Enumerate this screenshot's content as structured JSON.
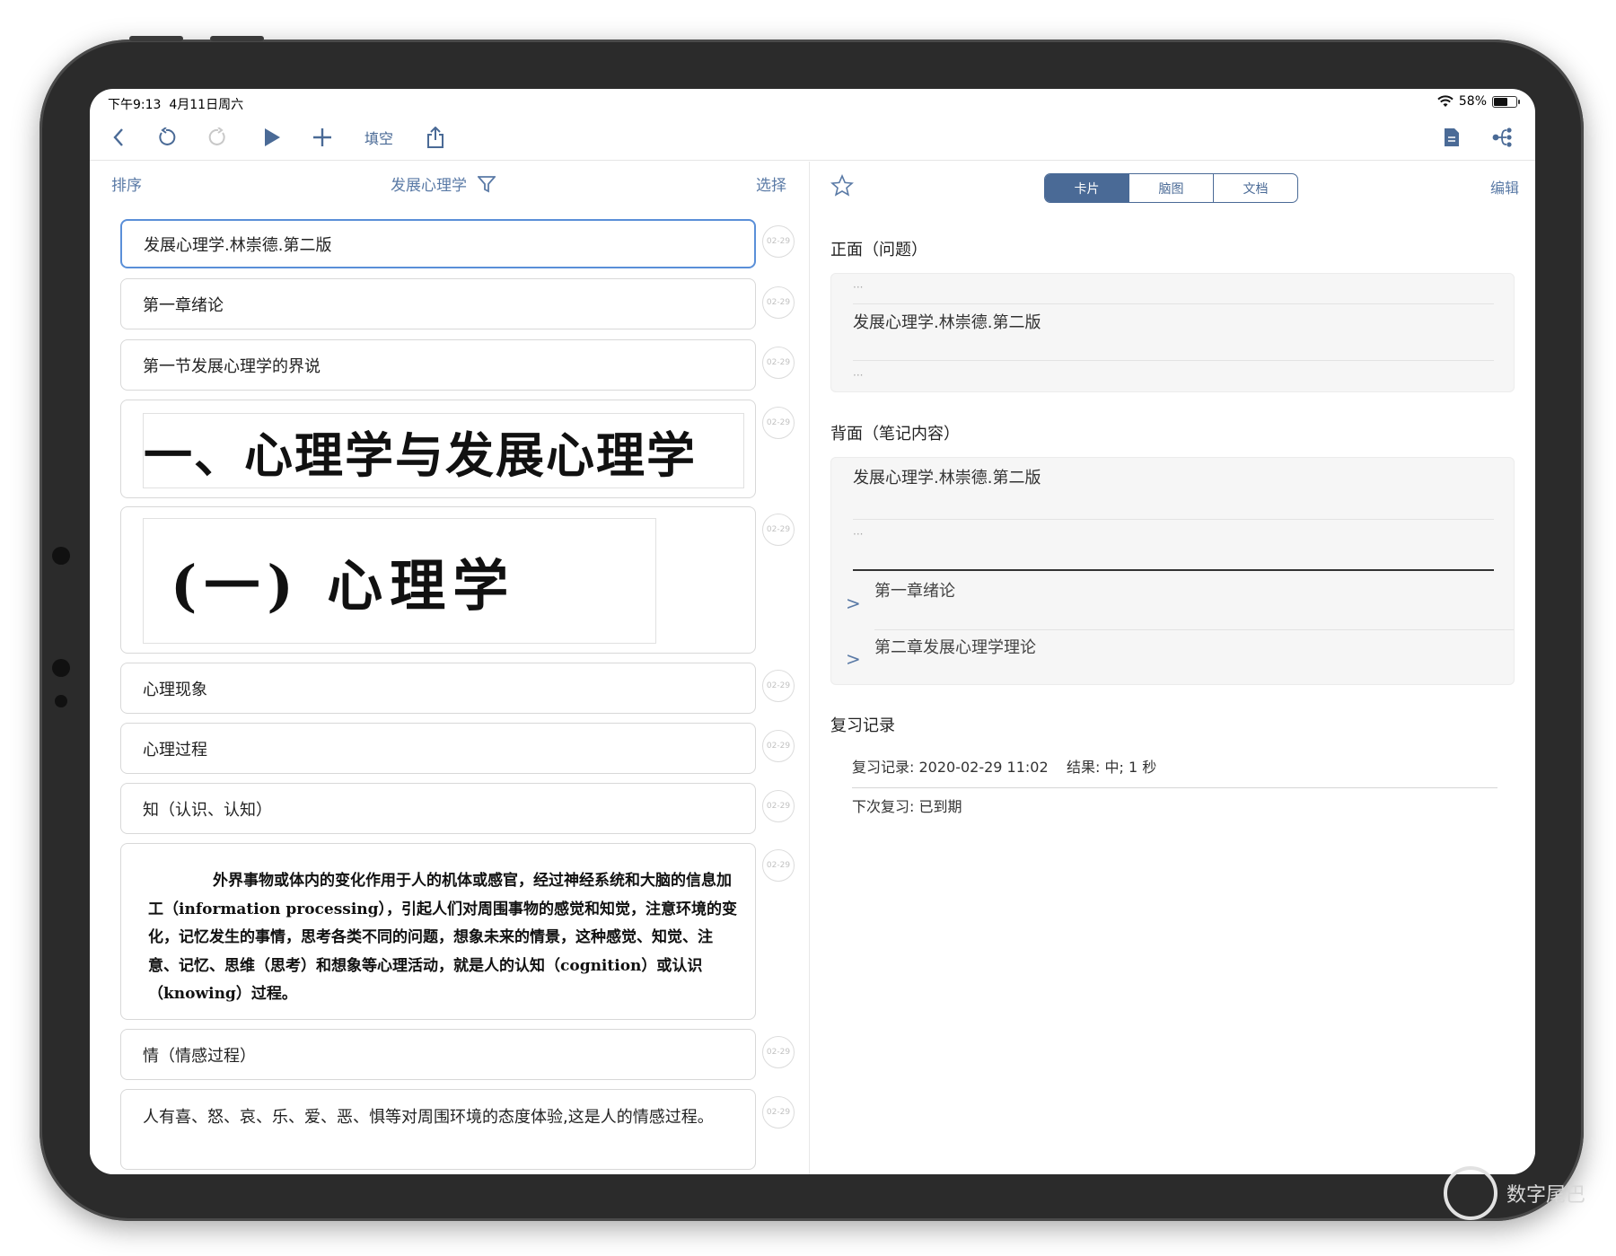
{
  "status_bar": {
    "time": "下午9:13",
    "date": "4月11日周六",
    "battery": "58%",
    "battery_level": 0.58
  },
  "toolbar": {
    "cloze_label": "填空"
  },
  "list_header": {
    "sort": "排序",
    "deck": "发展心理学",
    "select": "选择"
  },
  "cards": [
    {
      "text": "发展心理学.林崇德.第二版",
      "date": "02-29"
    },
    {
      "text": "第一章绪论",
      "date": "02-29"
    },
    {
      "text": "第一节发展心理学的界说",
      "date": "02-29"
    },
    {
      "image_text": "一、心理学与发展心理学",
      "date": "02-29"
    },
    {
      "image_text": "(一) 心理学",
      "date": "02-29"
    },
    {
      "text": "心理现象",
      "date": "02-29"
    },
    {
      "text": "心理过程",
      "date": "02-29"
    },
    {
      "text": "知（认识、认知）",
      "date": "02-29"
    },
    {
      "image_text": "外界事物或体内的变化作用于人的机体或感官，经过神经系统和大脑的信息加工（information processing），引起人们对周围事物的感觉和知觉，注意环境的变化，记忆发生的事情，思考各类不同的问题，想象未来的情景，这种感觉、知觉、注意、记忆、思维（思考）和想象等心理活动，就是人的认知（cognition）或认识（knowing）过程。",
      "date": "02-29"
    },
    {
      "text": "情（情感过程）",
      "date": "02-29"
    },
    {
      "text": "人有喜、怒、哀、乐、爱、恶、惧等对周围环境的态度体验,这是人的情感过程。",
      "date": "02-29"
    }
  ],
  "detail": {
    "tabs": [
      "卡片",
      "脑图",
      "文档"
    ],
    "edit": "编辑",
    "front_title": "正面（问题）",
    "front_text": "发展心理学.林崇德.第二版",
    "back_title": "背面（笔记内容）",
    "back_text": "发展心理学.林崇德.第二版",
    "children": [
      "第一章绪论",
      "第二章发展心理学理论"
    ],
    "review_title": "复习记录",
    "review_record": "复习记录: 2020-02-29 11:02    结果: 中; 1 秒",
    "next_review": "下次复习: 已到期",
    "ellipsis": "···"
  },
  "watermark": "数字尾巴",
  "colors": {
    "accent": "#4a6a96",
    "selected_border": "#5a8fd8",
    "frame": "#2b2b2b"
  }
}
